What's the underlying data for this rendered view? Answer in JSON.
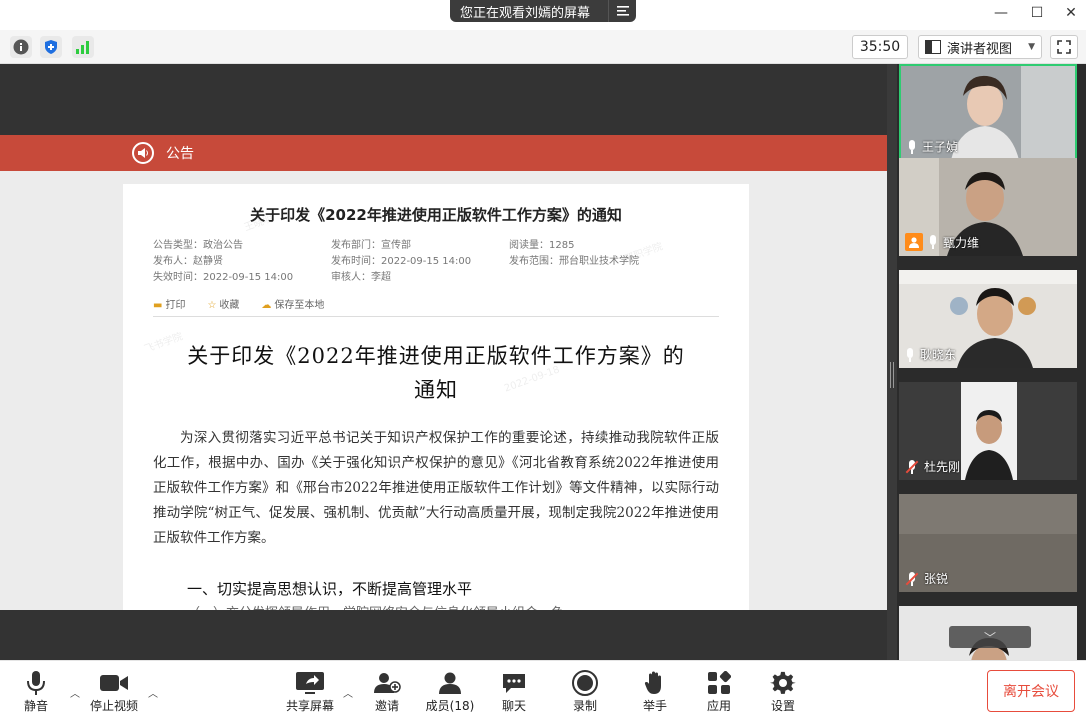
{
  "titlebar": {
    "share_notice": "您正在观看刘嫣的屏幕",
    "minimize_glyph": "—",
    "maximize_glyph": "☐",
    "close_glyph": "✕"
  },
  "toolbar": {
    "timer": "35:50",
    "view_mode": "演讲者视图",
    "icons": [
      "info-icon",
      "shield-icon",
      "signal-icon",
      "fullscreen-icon"
    ]
  },
  "shared_doc": {
    "banner_label": "公告",
    "doc_title": "关于印发《2022年推进使用正版软件工作方案》的通知",
    "meta": {
      "type": "公告类型：政治公告",
      "dept": "发布部门：宣传部",
      "views": "阅读量：1285",
      "publisher": "发布人：赵静贤",
      "time": "发布时间：2022-09-15 14:00",
      "site": "发布范围：邢台职业技术学院",
      "expire": "失效时间：2022-09-15 14:00",
      "reviewer": "审核人：李超"
    },
    "actions": [
      "打印",
      "收藏",
      "保存至本地"
    ],
    "big_title_line1": "关于印发《2022年推进使用正版软件工作方案》的",
    "big_title_line2": "通知",
    "paragraph": "为深入贯彻落实习近平总书记关于知识产权保护工作的重要论述，持续推动我院软件正版化工作，根据中办、国办《关于强化知识产权保护的意见》《河北省教育系统2022年推进使用正版软件工作方案》和《邢台市2022年推进使用正版软件工作计划》等文件精神，以实际行动推动学院“树正气、促发展、强机制、优贡献”大行动高质量开展，现制定我院2022年推进使用正版软件工作方案。",
    "heading1": "一、切实提高思想认识，不断提高管理水平",
    "cut_line": "（一）充分发挥领导作用。学院网络安全与信息化领导小组会，负",
    "watermarks": [
      "王晓明",
      "2022-09-18",
      "飞书学院",
      "邢职学院"
    ]
  },
  "participants": [
    {
      "name": "王子媜",
      "muted": false,
      "host": false
    },
    {
      "name": "甄力维",
      "muted": false,
      "host": true
    },
    {
      "name": "耿晓东",
      "muted": false,
      "host": false
    },
    {
      "name": "杜先刚",
      "muted": true,
      "host": false
    },
    {
      "name": "张锐",
      "muted": true,
      "host": false
    }
  ],
  "bottombar": {
    "mute": "静音",
    "stop_video": "停止视频",
    "share_screen": "共享屏幕",
    "invite": "邀请",
    "members": "成员(18)",
    "chat": "聊天",
    "record": "录制",
    "raise_hand": "举手",
    "apps": "应用",
    "settings": "设置",
    "leave": "离开会议"
  }
}
